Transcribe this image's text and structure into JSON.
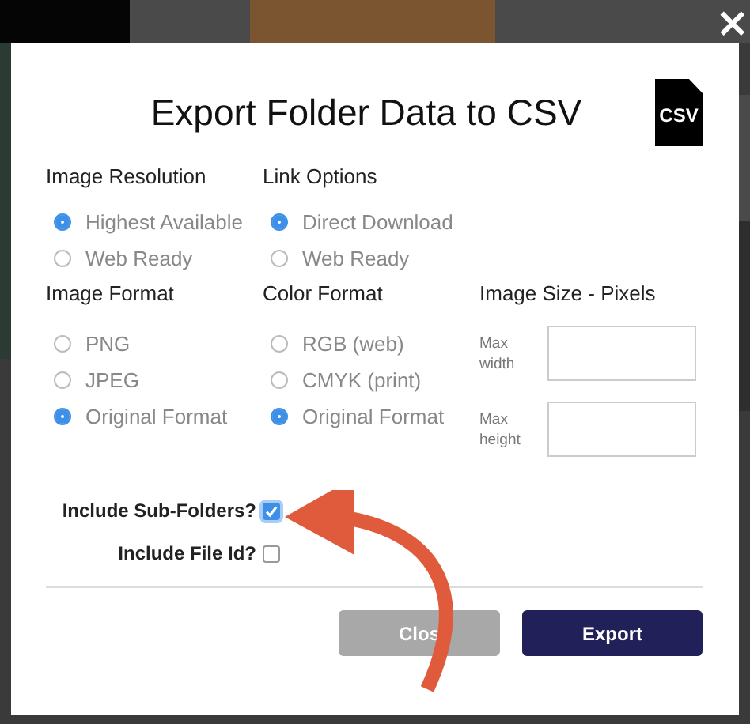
{
  "dialog": {
    "title": "Export Folder Data to CSV",
    "icon_text": "CSV",
    "close_symbol": "×"
  },
  "option_groups": [
    {
      "heading": "Image Resolution",
      "options": [
        {
          "label": "Highest Available",
          "selected": true
        },
        {
          "label": "Web Ready",
          "selected": false
        }
      ]
    },
    {
      "heading": "Link Options",
      "options": [
        {
          "label": "Direct Download",
          "selected": true
        },
        {
          "label": "Web Ready",
          "selected": false
        }
      ]
    },
    {
      "heading": "Image Format",
      "options": [
        {
          "label": "PNG",
          "selected": false
        },
        {
          "label": "JPEG",
          "selected": false
        },
        {
          "label": "Original Format",
          "selected": true
        }
      ]
    },
    {
      "heading": "Color Format",
      "options": [
        {
          "label": "RGB (web)",
          "selected": false
        },
        {
          "label": "CMYK (print)",
          "selected": false
        },
        {
          "label": "Original Format",
          "selected": true
        }
      ]
    }
  ],
  "image_size": {
    "heading": "Image Size - Pixels",
    "fields": [
      {
        "label": "Max width"
      },
      {
        "label": "Max height"
      }
    ]
  },
  "checkboxes": [
    {
      "label": "Include Sub-Folders?",
      "checked": true
    },
    {
      "label": "Include File Id?",
      "checked": false
    }
  ],
  "buttons": [
    {
      "label": "Clos",
      "kind": "secondary"
    },
    {
      "label": "Export",
      "kind": "primary"
    }
  ]
}
